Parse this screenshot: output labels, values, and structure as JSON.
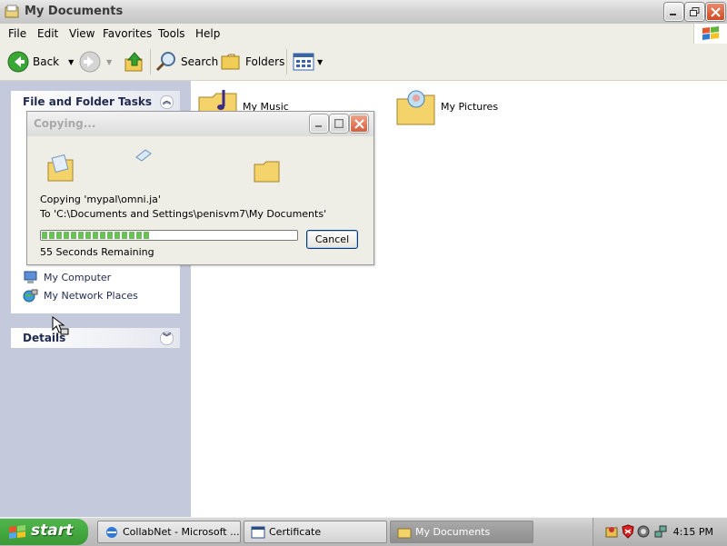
{
  "window": {
    "title": "My Documents",
    "menu": [
      "File",
      "Edit",
      "View",
      "Favorites",
      "Tools",
      "Help"
    ]
  },
  "toolbar": {
    "back_label": "Back",
    "search_label": "Search",
    "folders_label": "Folders"
  },
  "taskpane": {
    "file_tasks_title": "File and Folder Tasks",
    "other_places_links": [
      "My Computer",
      "My Network Places"
    ],
    "details_title": "Details"
  },
  "content": {
    "items": [
      "My Music",
      "My Pictures"
    ]
  },
  "dialog": {
    "title": "Copying...",
    "line1": "Copying 'mypal\\omni.ja'",
    "line2": "To 'C:\\Documents and Settings\\penisvm7\\My Documents'",
    "remaining": "55 Seconds Remaining",
    "cancel_label": "Cancel",
    "progress_fraction": 0.43
  },
  "taskbar": {
    "start_label": "start",
    "tasks": [
      "CollabNet - Microsoft ...",
      "Certificate",
      "My Documents"
    ],
    "clock": "4:15 PM"
  },
  "colors": {
    "taskpane_bg": "#c5c9dc",
    "start_green": "#3a9a35",
    "progress_green": "#6dbf5a"
  }
}
